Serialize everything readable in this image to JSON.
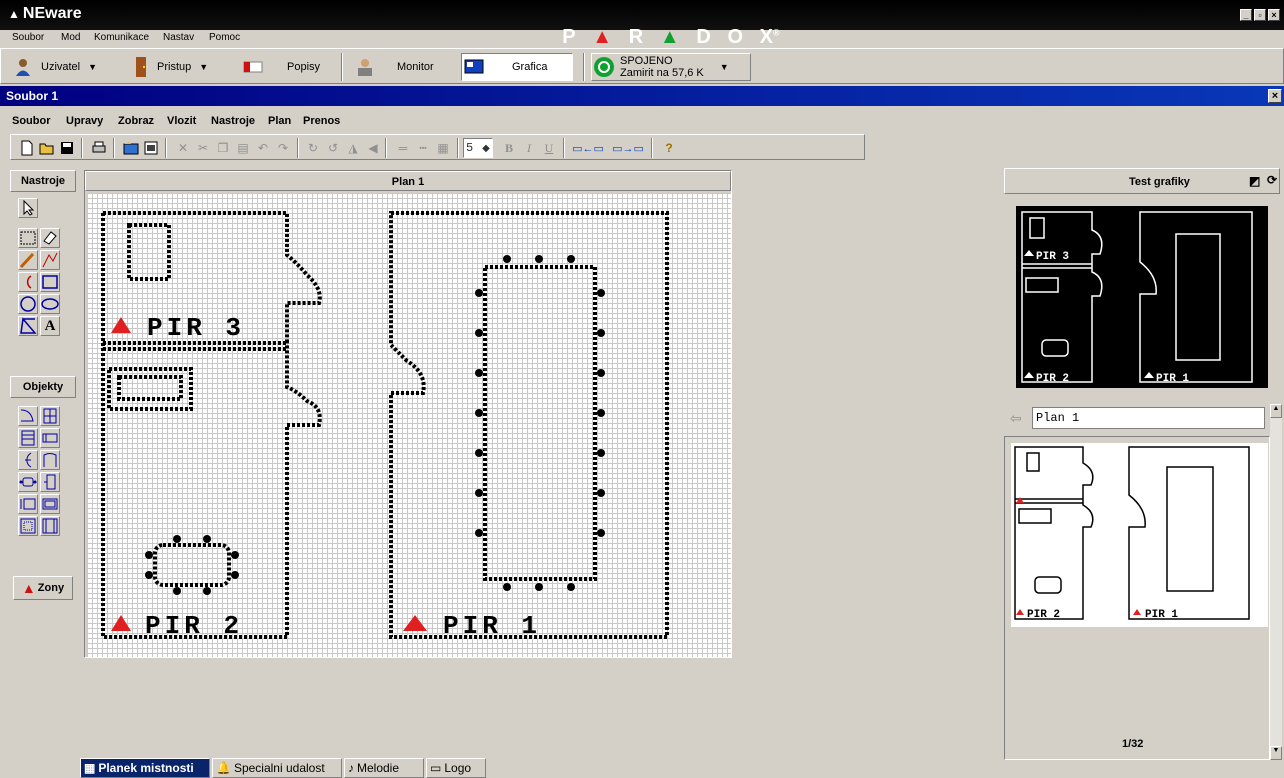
{
  "app": {
    "title": "NEware",
    "brand_letters": [
      "P",
      "R",
      "D",
      "O",
      "X"
    ],
    "brand_mark": "®"
  },
  "main_menu": [
    "Soubor",
    "Mod",
    "Komunikace",
    "Nastav",
    "Pomoc"
  ],
  "toolbar1": {
    "user_label": "Uzivatel",
    "access_label": "Pristup",
    "labels_label": "Popisy",
    "monitor_label": "Monitor",
    "graphics_label": "Grafica",
    "connection_status": "SPOJENO",
    "connection_detail": "Zamirit na  57,6 K"
  },
  "document": {
    "title": "Soubor 1"
  },
  "sub_menu": [
    "Soubor",
    "Upravy",
    "Zobraz",
    "Vlozit",
    "Nastroje",
    "Plan",
    "Prenos"
  ],
  "toolbar2": {
    "line_width": "5"
  },
  "tool_panel": {
    "tools_label": "Nastroje",
    "objects_label": "Objekty",
    "zones_label": "Zony"
  },
  "plan": {
    "title": "Plan 1",
    "zones": [
      "PIR 3",
      "PIR 2",
      "PIR 1"
    ]
  },
  "right_panel": {
    "title": "Test grafiky",
    "selected_plan": "Plan 1",
    "preview_labels": [
      "PIR 3",
      "PIR 2",
      "PIR 1"
    ],
    "thumb_labels": [
      "PIR 2",
      "PIR 1"
    ],
    "page_count": "1/32"
  },
  "bottom_tabs": [
    "Planek mistnosti",
    "Specialni udalost",
    "Melodie",
    "Logo"
  ],
  "colors": {
    "title_blue": "#000080",
    "zone_red": "#e02020",
    "brand_green": "#10a030"
  }
}
